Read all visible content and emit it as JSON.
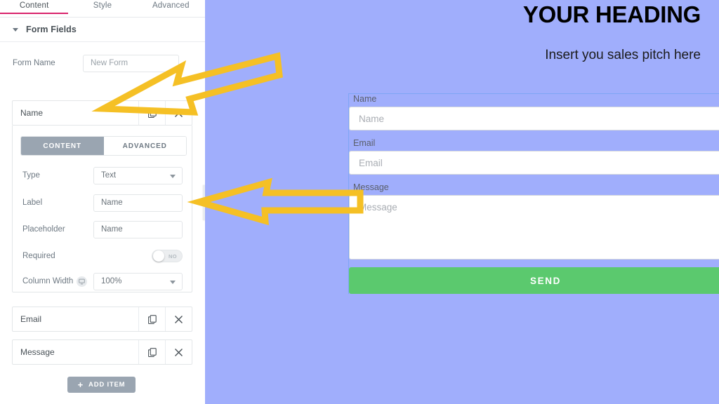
{
  "editor": {
    "tabs": [
      {
        "label": "Content",
        "active": true
      },
      {
        "label": "Style",
        "active": false
      },
      {
        "label": "Advanced",
        "active": false
      }
    ],
    "section": {
      "title": "Form Fields"
    },
    "form_name": {
      "label": "Form Name",
      "value": "New Form"
    },
    "fields": [
      {
        "name": "Name",
        "duplicate_icon": "copy-icon",
        "remove_icon": "close-icon"
      },
      {
        "name": "Email",
        "duplicate_icon": "copy-icon",
        "remove_icon": "close-icon"
      },
      {
        "name": "Message",
        "duplicate_icon": "copy-icon",
        "remove_icon": "close-icon"
      }
    ],
    "field_settings": {
      "segments": [
        {
          "label": "CONTENT",
          "active": true
        },
        {
          "label": "ADVANCED",
          "active": false
        }
      ],
      "type": {
        "label": "Type",
        "value": "Text"
      },
      "label": {
        "label": "Label",
        "value": "Name"
      },
      "placeholder": {
        "label": "Placeholder",
        "value": "Name"
      },
      "required": {
        "label": "Required",
        "value": "NO",
        "enabled": false
      },
      "column_width": {
        "label": "Column Width",
        "value": "100%",
        "device_icon": "desktop-icon"
      }
    },
    "add_item": {
      "label": "ADD ITEM",
      "icon": "plus-icon"
    },
    "accent_color": "#d9226b",
    "segment_active_color": "#9aa5b1"
  },
  "preview": {
    "background_color": "#a0aefc",
    "heading": "YOUR HEADING",
    "subheading": "Insert you sales pitch here",
    "fields": [
      {
        "label": "Name",
        "placeholder": "Name",
        "type": "text"
      },
      {
        "label": "Email",
        "placeholder": "Email",
        "type": "text"
      },
      {
        "label": "Message",
        "placeholder": "Message",
        "type": "textarea"
      }
    ],
    "submit": {
      "label": "SEND",
      "color": "#5bc96e"
    }
  },
  "annotations": {
    "arrow_color": "#f5c025",
    "arrows": [
      {
        "name": "arrow-to-field-row",
        "points_to": "Name field row"
      },
      {
        "name": "arrow-to-label-input",
        "points_to": "Label input"
      }
    ]
  }
}
